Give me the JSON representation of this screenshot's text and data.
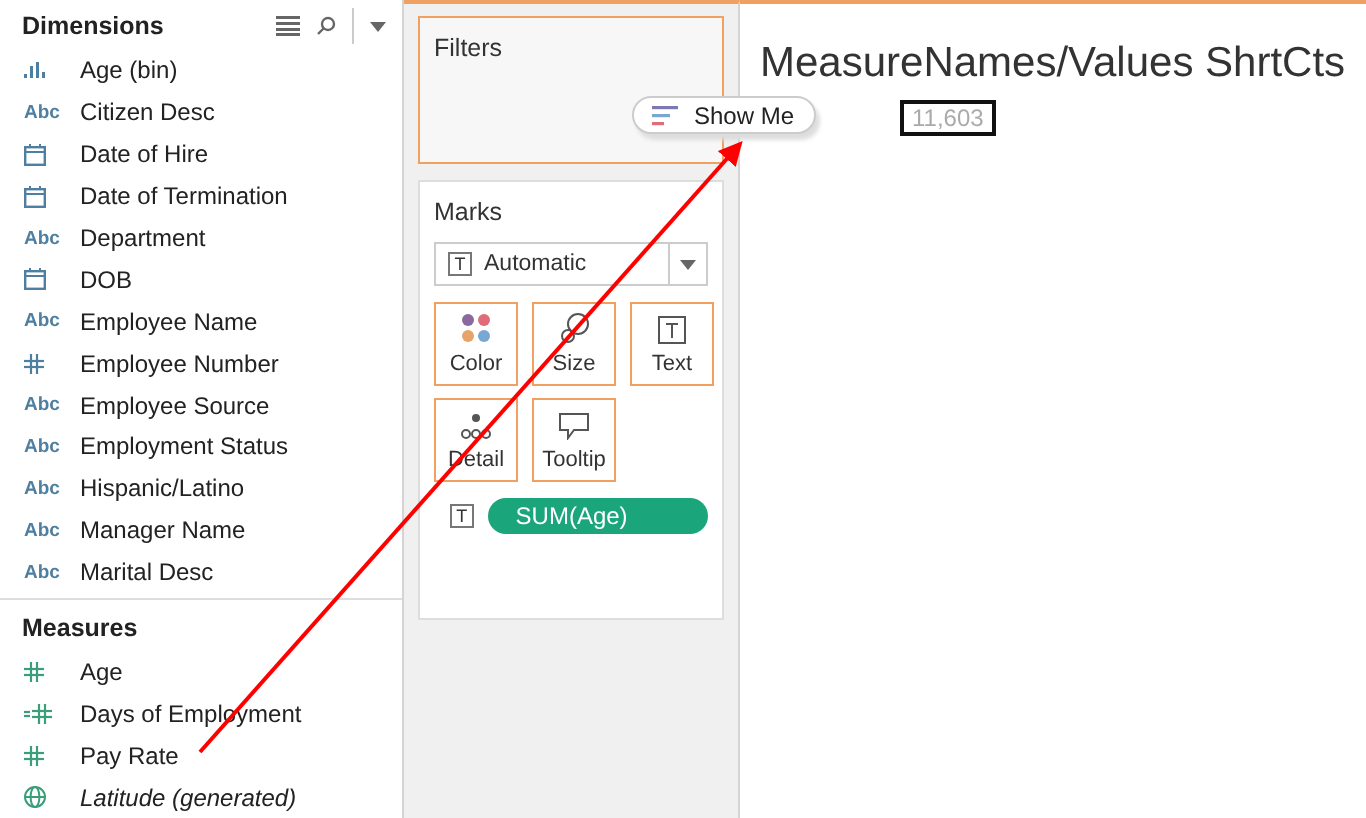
{
  "dimensions": {
    "title": "Dimensions",
    "items": [
      {
        "label": "Age (bin)",
        "kind": "bin"
      },
      {
        "label": "Citizen Desc",
        "kind": "text",
        "type_label": "Abc"
      },
      {
        "label": "Date of Hire",
        "kind": "date"
      },
      {
        "label": "Date of Termination",
        "kind": "date"
      },
      {
        "label": "Department",
        "kind": "text",
        "type_label": "Abc"
      },
      {
        "label": "DOB",
        "kind": "date"
      },
      {
        "label": "Employee Name",
        "kind": "text",
        "type_label": "Abc"
      },
      {
        "label": "Employee Number",
        "kind": "number"
      },
      {
        "label": "Employee Source",
        "kind": "text",
        "type_label": "Abc"
      },
      {
        "label": "Employment Status",
        "kind": "text",
        "type_label": "Abc"
      },
      {
        "label": "Hispanic/Latino",
        "kind": "text",
        "type_label": "Abc"
      },
      {
        "label": "Manager Name",
        "kind": "text",
        "type_label": "Abc"
      },
      {
        "label": "Marital Desc",
        "kind": "text",
        "type_label": "Abc"
      }
    ]
  },
  "measures": {
    "title": "Measures",
    "items": [
      {
        "label": "Age",
        "kind": "number"
      },
      {
        "label": "Days of Employment",
        "kind": "calc"
      },
      {
        "label": "Pay Rate",
        "kind": "number"
      },
      {
        "label": "Latitude (generated)",
        "kind": "geo"
      }
    ]
  },
  "filters": {
    "title": "Filters"
  },
  "marks": {
    "title": "Marks",
    "mark_type": "Automatic",
    "mark_type_icon": "T",
    "cards": [
      {
        "label": "Color",
        "kind": "color"
      },
      {
        "label": "Size",
        "kind": "size"
      },
      {
        "label": "Text",
        "kind": "text"
      },
      {
        "label": "Detail",
        "kind": "detail"
      },
      {
        "label": "Tooltip",
        "kind": "tooltip"
      }
    ],
    "pills": [
      {
        "label": "SUM(Age)",
        "kind": "text",
        "icon": "T"
      }
    ]
  },
  "sheet": {
    "title": "MeasureNames/Values ShrtCts",
    "value": "11,603"
  },
  "show_me": {
    "label": "Show Me"
  }
}
